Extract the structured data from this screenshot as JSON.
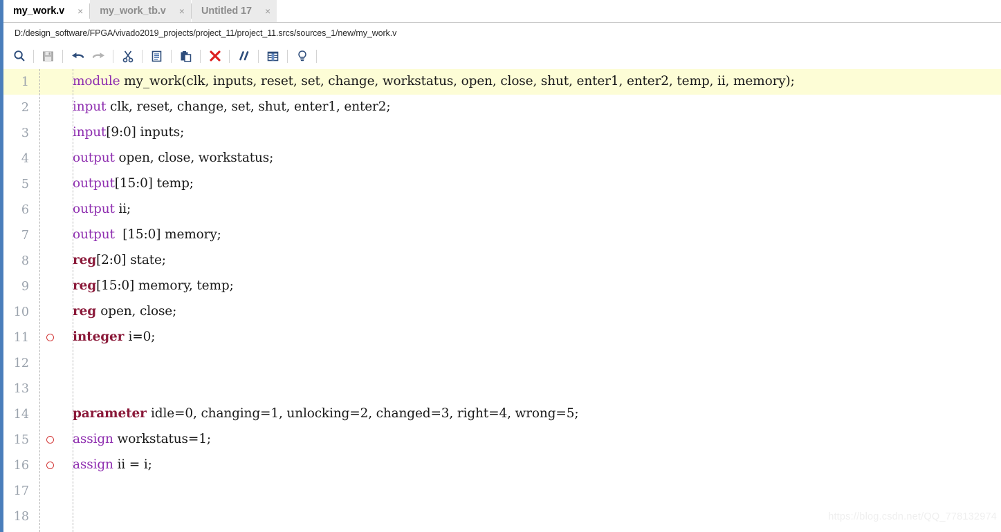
{
  "window": {
    "accent_color": "#4a7ebb"
  },
  "tabs": {
    "items": [
      {
        "label": "my_work.v",
        "active": true,
        "close": "×"
      },
      {
        "label": "my_work_tb.v",
        "active": false,
        "close": "×"
      },
      {
        "label": "Untitled 17",
        "active": false,
        "close": "×"
      }
    ]
  },
  "path_bar": {
    "path": "D:/design_software/FPGA/vivado2019_projects/project_11/project_11.srcs/sources_1/new/my_work.v"
  },
  "toolbar": {
    "buttons": [
      {
        "name": "search-icon",
        "title": "Find",
        "enabled": true
      },
      {
        "name": "save-icon",
        "title": "Save File",
        "enabled": false
      },
      {
        "name": "undo-icon",
        "title": "Undo",
        "enabled": true
      },
      {
        "name": "redo-icon",
        "title": "Redo",
        "enabled": false
      },
      {
        "name": "cut-icon",
        "title": "Cut",
        "enabled": true
      },
      {
        "name": "copy-icon",
        "title": "Copy",
        "enabled": true
      },
      {
        "name": "paste-icon",
        "title": "Paste",
        "enabled": true
      },
      {
        "name": "delete-icon",
        "title": "Delete",
        "enabled": true
      },
      {
        "name": "comment-icon",
        "title": "Toggle Comment",
        "enabled": true
      },
      {
        "name": "split-view-icon",
        "title": "Column View",
        "enabled": true
      },
      {
        "name": "lightbulb-icon",
        "title": "Hints",
        "enabled": true
      }
    ]
  },
  "editor": {
    "highlighted_line": 1,
    "breakpoint_lines": [
      11,
      15,
      16
    ],
    "syntax_colors": {
      "keyword_purple": "#8f2fb0",
      "keyword_darkred": "#8b1a3a",
      "plain": "#1a1a1a",
      "line_number": "#9ba3ad",
      "current_line_bg": "#fdfdd6"
    },
    "lines": [
      {
        "n": "1",
        "marker": false,
        "segs": [
          {
            "t": "module ",
            "c": "kw-purple"
          },
          {
            "t": "my_work(clk, inputs, reset, set, change, workstatus, open, close, shut, enter1, enter2, temp, ii, memory);",
            "c": ""
          }
        ]
      },
      {
        "n": "2",
        "marker": false,
        "segs": [
          {
            "t": "input ",
            "c": "kw-purple"
          },
          {
            "t": "clk, reset, change, set, shut, enter1, enter2;",
            "c": ""
          }
        ]
      },
      {
        "n": "3",
        "marker": false,
        "segs": [
          {
            "t": "input",
            "c": "kw-purple"
          },
          {
            "t": "[9:0] inputs;",
            "c": ""
          }
        ]
      },
      {
        "n": "4",
        "marker": false,
        "segs": [
          {
            "t": "output ",
            "c": "kw-purple"
          },
          {
            "t": "open, close, workstatus;",
            "c": ""
          }
        ]
      },
      {
        "n": "5",
        "marker": false,
        "segs": [
          {
            "t": "output",
            "c": "kw-purple"
          },
          {
            "t": "[15:0] temp;",
            "c": ""
          }
        ]
      },
      {
        "n": "6",
        "marker": false,
        "segs": [
          {
            "t": "output ",
            "c": "kw-purple"
          },
          {
            "t": "ii;",
            "c": ""
          }
        ]
      },
      {
        "n": "7",
        "marker": false,
        "segs": [
          {
            "t": "output ",
            "c": "kw-purple"
          },
          {
            "t": " [15:0] memory;",
            "c": ""
          }
        ]
      },
      {
        "n": "8",
        "marker": false,
        "segs": [
          {
            "t": "reg",
            "c": "kw-darkred"
          },
          {
            "t": "[2:0] state;",
            "c": ""
          }
        ]
      },
      {
        "n": "9",
        "marker": false,
        "segs": [
          {
            "t": "reg",
            "c": "kw-darkred"
          },
          {
            "t": "[15:0] memory, temp;",
            "c": ""
          }
        ]
      },
      {
        "n": "10",
        "marker": false,
        "segs": [
          {
            "t": "reg ",
            "c": "kw-darkred"
          },
          {
            "t": "open, close;",
            "c": ""
          }
        ]
      },
      {
        "n": "11",
        "marker": true,
        "segs": [
          {
            "t": "integer ",
            "c": "kw-darkred"
          },
          {
            "t": "i=0;",
            "c": ""
          }
        ]
      },
      {
        "n": "12",
        "marker": false,
        "segs": [
          {
            "t": "",
            "c": ""
          }
        ]
      },
      {
        "n": "13",
        "marker": false,
        "segs": [
          {
            "t": "",
            "c": ""
          }
        ]
      },
      {
        "n": "14",
        "marker": false,
        "segs": [
          {
            "t": "parameter ",
            "c": "kw-darkred"
          },
          {
            "t": "idle=0, changing=1, unlocking=2, changed=3, right=4, wrong=5;",
            "c": ""
          }
        ]
      },
      {
        "n": "15",
        "marker": true,
        "segs": [
          {
            "t": "assign ",
            "c": "kw-purple"
          },
          {
            "t": "workstatus=1;",
            "c": ""
          }
        ]
      },
      {
        "n": "16",
        "marker": true,
        "segs": [
          {
            "t": "assign ",
            "c": "kw-purple"
          },
          {
            "t": "ii = i;",
            "c": ""
          }
        ]
      },
      {
        "n": "17",
        "marker": false,
        "segs": [
          {
            "t": "",
            "c": ""
          }
        ]
      },
      {
        "n": "18",
        "marker": false,
        "segs": [
          {
            "t": "",
            "c": ""
          }
        ]
      }
    ]
  },
  "watermark": {
    "text": "https://blog.csdn.net/QQ_778132974"
  }
}
